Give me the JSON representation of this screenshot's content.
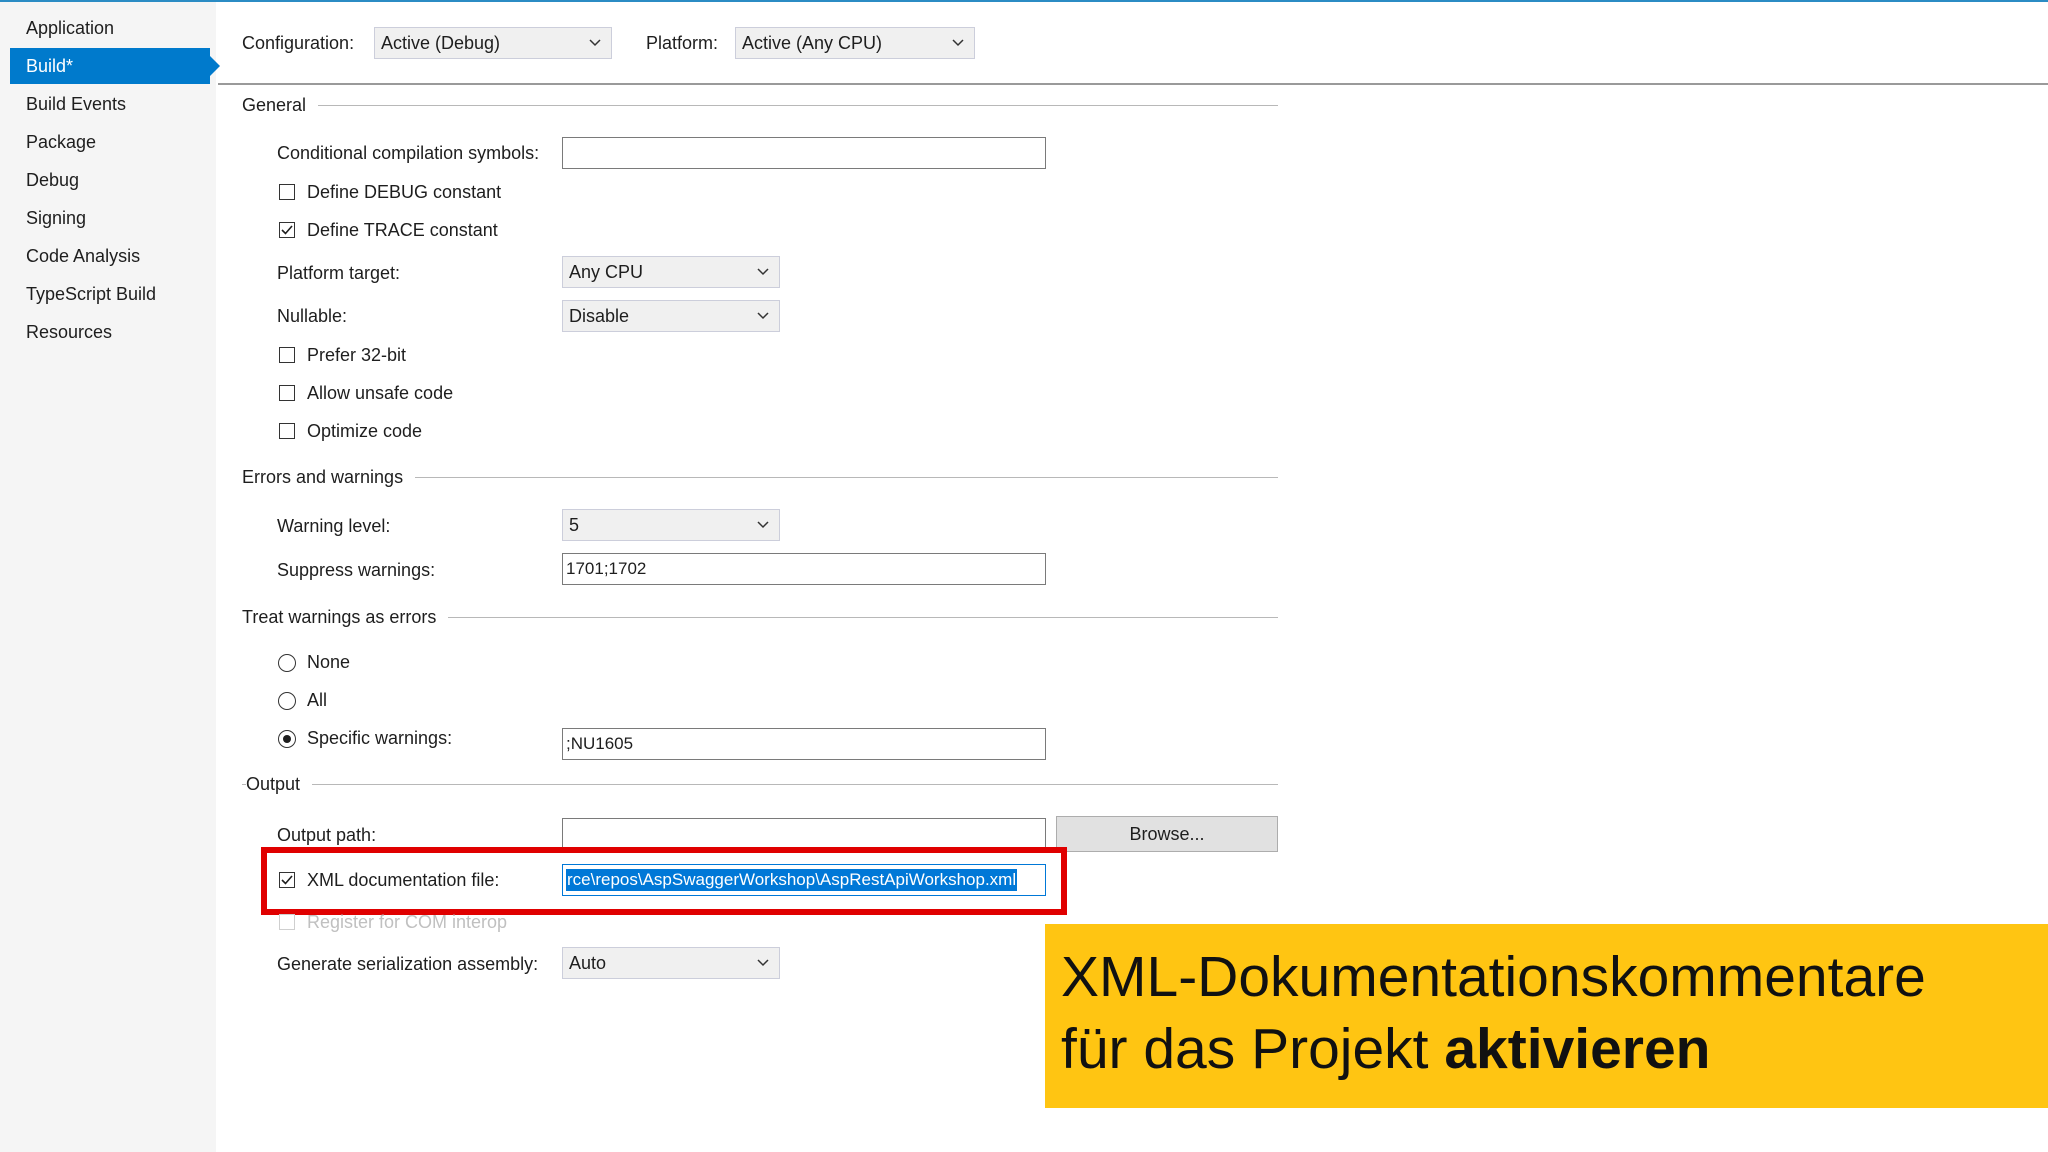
{
  "colors": {
    "accent": "#007acc",
    "highlight_border": "#e00000",
    "banner_bg": "#ffc512",
    "selection": "#0078d7"
  },
  "sidebar": {
    "items": [
      {
        "label": "Application"
      },
      {
        "label": "Build*",
        "active": true
      },
      {
        "label": "Build Events"
      },
      {
        "label": "Package"
      },
      {
        "label": "Debug"
      },
      {
        "label": "Signing"
      },
      {
        "label": "Code Analysis"
      },
      {
        "label": "TypeScript Build"
      },
      {
        "label": "Resources"
      }
    ]
  },
  "toolbar": {
    "configuration_label": "Configuration:",
    "configuration_value": "Active (Debug)",
    "platform_label": "Platform:",
    "platform_value": "Active (Any CPU)"
  },
  "general": {
    "title": "General",
    "conditional_symbols_label": "Conditional compilation symbols:",
    "conditional_symbols_value": "",
    "define_debug_label": "Define DEBUG constant",
    "define_debug_checked": false,
    "define_trace_label": "Define TRACE constant",
    "define_trace_checked": true,
    "platform_target_label": "Platform target:",
    "platform_target_value": "Any CPU",
    "nullable_label": "Nullable:",
    "nullable_value": "Disable",
    "prefer32_label": "Prefer 32-bit",
    "unsafe_label": "Allow unsafe code",
    "optimize_label": "Optimize code"
  },
  "errors": {
    "title": "Errors and warnings",
    "warning_level_label": "Warning level:",
    "warning_level_value": "5",
    "suppress_label": "Suppress warnings:",
    "suppress_value": "1701;1702"
  },
  "treat": {
    "title": "Treat warnings as errors",
    "none_label": "None",
    "all_label": "All",
    "specific_label": "Specific warnings:",
    "specific_value": ";NU1605",
    "selected": "specific"
  },
  "output": {
    "title": "Output",
    "path_label": "Output path:",
    "path_value": "",
    "browse_label": "Browse...",
    "xml_label": "XML documentation file:",
    "xml_checked": true,
    "xml_value": "rce\\repos\\AspSwaggerWorkshop\\AspRestApiWorkshop.xml",
    "com_label": "Register for COM interop",
    "serialization_label": "Generate serialization assembly:",
    "serialization_value": "Auto"
  },
  "banner": {
    "line1": "XML-Dokumentationskommentare",
    "line2_regular": "für das Projekt ",
    "line2_bold": "aktivieren"
  }
}
